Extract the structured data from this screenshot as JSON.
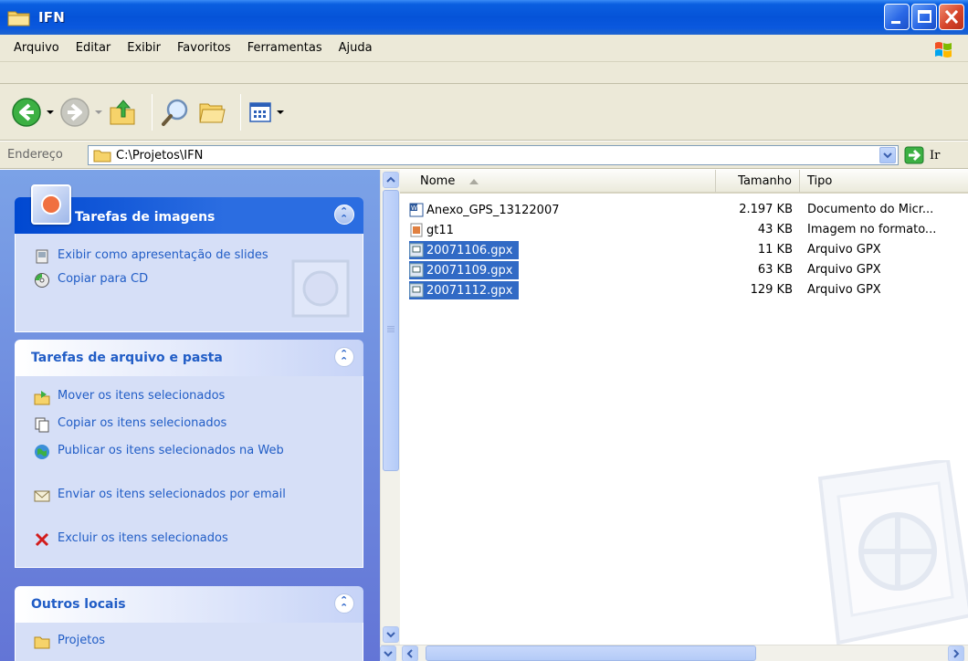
{
  "window": {
    "title": "IFN",
    "folder_icon": "folder-icon",
    "buttons": [
      "minimize-icon",
      "maximize-icon",
      "close-icon"
    ]
  },
  "menu": {
    "items": [
      "Arquivo",
      "Editar",
      "Exibir",
      "Favoritos",
      "Ferramentas",
      "Ajuda"
    ]
  },
  "toolbar": {
    "buttons": [
      "back-icon",
      "forward-icon",
      "up-folder-icon",
      "search-icon",
      "folders-icon",
      "views-icon"
    ]
  },
  "address": {
    "label": "Endereço",
    "path": "C:\\Projetos\\IFN",
    "go_label": "Ir"
  },
  "taskpane": {
    "image_tasks": {
      "title": "Tarefas de imagens",
      "items": [
        "Exibir como apresentação de slides",
        "Copiar para CD"
      ]
    },
    "file_tasks": {
      "title": "Tarefas de arquivo e pasta",
      "items": [
        "Mover os itens selecionados",
        "Copiar os itens selecionados",
        "Publicar os itens selecionados na Web",
        "Enviar os itens selecionados por email",
        "Excluir os itens selecionados"
      ]
    },
    "other_places": {
      "title": "Outros locais",
      "items": [
        "Projetos"
      ]
    }
  },
  "filelist": {
    "columns": [
      "Nome",
      "Tamanho",
      "Tipo"
    ],
    "rows": [
      {
        "name": "Anexo_GPS_13122007",
        "size": "2.197 KB",
        "type": "Documento do Micr...",
        "icon": "word-doc-icon",
        "selected": false
      },
      {
        "name": "gt11",
        "size": "43 KB",
        "type": "Imagem no formato...",
        "icon": "image-file-icon",
        "selected": false
      },
      {
        "name": "20071106.gpx",
        "size": "11 KB",
        "type": "Arquivo GPX",
        "icon": "gpx-file-icon",
        "selected": true
      },
      {
        "name": "20071109.gpx",
        "size": "63 KB",
        "type": "Arquivo GPX",
        "icon": "gpx-file-icon",
        "selected": true
      },
      {
        "name": "20071112.gpx",
        "size": "129 KB",
        "type": "Arquivo GPX",
        "icon": "gpx-file-icon",
        "selected": true
      }
    ]
  },
  "colors": {
    "titlebar": "#0553d8",
    "selection": "#316ac5",
    "task_link": "#215dc6",
    "taskpane_bg": "#7ba2e7"
  }
}
